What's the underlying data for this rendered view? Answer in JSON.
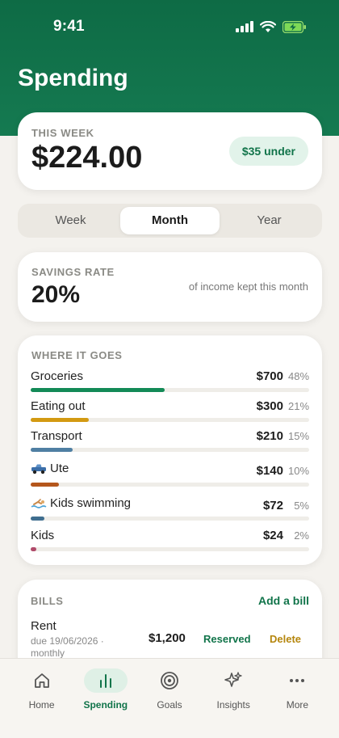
{
  "status_bar": {
    "time": "9:41"
  },
  "header": {
    "title": "Spending"
  },
  "this_week": {
    "label": "THIS WEEK",
    "amount": "$224.00",
    "badge": "$35 under"
  },
  "period_tabs": [
    {
      "label": "Week",
      "active": false
    },
    {
      "label": "Month",
      "active": true
    },
    {
      "label": "Year",
      "active": false
    }
  ],
  "savings": {
    "label": "SAVINGS RATE",
    "value": "20%",
    "note": "of income kept this month"
  },
  "where_it_goes": {
    "label": "WHERE IT GOES",
    "categories": [
      {
        "name": "Groceries",
        "amount": "$700",
        "percent": "48%",
        "fill": 0.48,
        "color": "#138a57",
        "icon": ""
      },
      {
        "name": "Eating out",
        "amount": "$300",
        "percent": "21%",
        "fill": 0.21,
        "color": "#d39a12",
        "icon": ""
      },
      {
        "name": "Transport",
        "amount": "$210",
        "percent": "15%",
        "fill": 0.15,
        "color": "#4f7fa3",
        "icon": ""
      },
      {
        "name": "Ute",
        "amount": "$140",
        "percent": "10%",
        "fill": 0.1,
        "color": "#b4561c",
        "icon": "pickup-truck-icon"
      },
      {
        "name": "Kids swimming",
        "amount": "$72",
        "percent": "5%",
        "fill": 0.05,
        "color": "#3f6e8f",
        "icon": "swimmer-icon"
      },
      {
        "name": "Kids",
        "amount": "$24",
        "percent": "2%",
        "fill": 0.02,
        "color": "#b04a6a",
        "icon": ""
      }
    ]
  },
  "bills": {
    "label": "BILLS",
    "add_label": "Add a bill",
    "items": [
      {
        "name": "Rent",
        "due": "due 19/06/2026 · monthly",
        "amount": "$1,200",
        "status": "Reserved",
        "action": "Delete"
      }
    ]
  },
  "tab_bar": [
    {
      "label": "Home",
      "icon": "home-icon",
      "active": false
    },
    {
      "label": "Spending",
      "icon": "bar-chart-icon",
      "active": true
    },
    {
      "label": "Goals",
      "icon": "target-icon",
      "active": false
    },
    {
      "label": "Insights",
      "icon": "sparkle-icon",
      "active": false
    },
    {
      "label": "More",
      "icon": "more-icon",
      "active": false
    }
  ],
  "colors": {
    "brand": "#0e6b45",
    "accent": "#11744a",
    "warning": "#b5860d"
  }
}
